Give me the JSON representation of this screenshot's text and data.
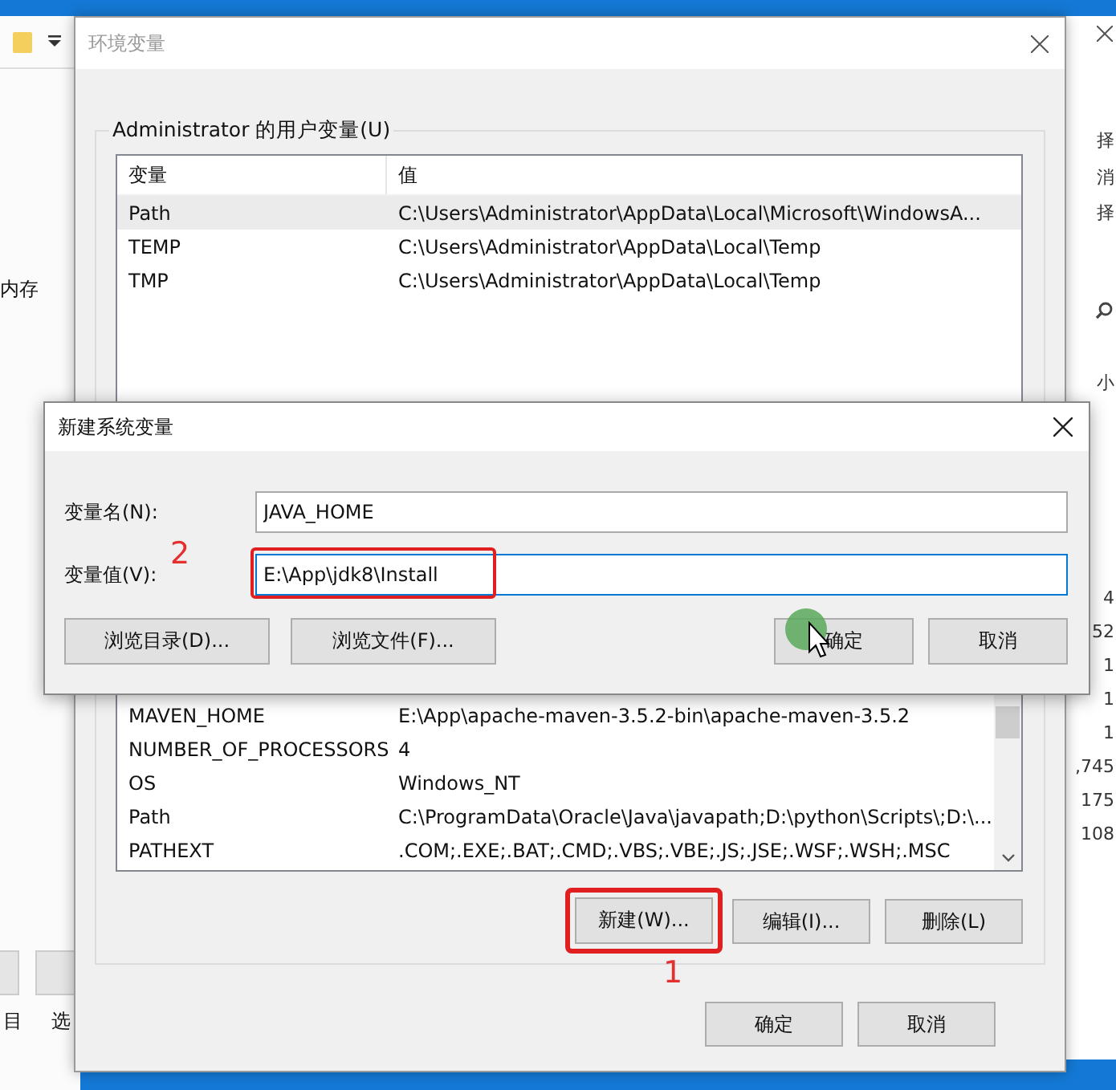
{
  "background_left": {
    "texts": [
      "内存",
      "目",
      "选"
    ]
  },
  "background_right": {
    "texts": [
      "择",
      "消",
      "择",
      "小",
      "4",
      "52",
      "1",
      "1",
      "1",
      ",745",
      "175",
      "108"
    ]
  },
  "env_window": {
    "title": "环境变量",
    "user_vars": {
      "label": "Administrator 的用户变量(U)",
      "columns": [
        "变量",
        "值"
      ],
      "rows": [
        {
          "name": "Path",
          "value": "C:\\Users\\Administrator\\AppData\\Local\\Microsoft\\WindowsA...",
          "selected": true
        },
        {
          "name": "TEMP",
          "value": "C:\\Users\\Administrator\\AppData\\Local\\Temp",
          "selected": false
        },
        {
          "name": "TMP",
          "value": "C:\\Users\\Administrator\\AppData\\Local\\Temp",
          "selected": false
        }
      ]
    },
    "system_vars": {
      "rows": [
        {
          "name": "MAVEN_HOME",
          "value": "E:\\App\\apache-maven-3.5.2-bin\\apache-maven-3.5.2",
          "selected": false
        },
        {
          "name": "NUMBER_OF_PROCESSORS",
          "value": "4",
          "selected": false
        },
        {
          "name": "OS",
          "value": "Windows_NT",
          "selected": false
        },
        {
          "name": "Path",
          "value": "C:\\ProgramData\\Oracle\\Java\\javapath;D:\\python\\Scripts\\;D:\\...",
          "selected": false
        },
        {
          "name": "PATHEXT",
          "value": ".COM;.EXE;.BAT;.CMD;.VBS;.VBE;.JS;.JSE;.WSF;.WSH;.MSC",
          "selected": false
        }
      ]
    },
    "buttons": [
      {
        "label": "新建(W)...",
        "highlighted": true
      },
      {
        "label": "编辑(I)...",
        "highlighted": false
      },
      {
        "label": "删除(L)",
        "highlighted": false
      }
    ],
    "step_mark": "1",
    "footer_buttons": [
      "确定",
      "取消"
    ]
  },
  "new_var_dialog": {
    "title": "新建系统变量",
    "step_mark": "2",
    "fields": [
      {
        "label": "变量名(N):",
        "value": "JAVA_HOME",
        "focused": false,
        "highlighted": false
      },
      {
        "label": "变量值(V):",
        "value": "E:\\App\\jdk8\\Install",
        "focused": true,
        "highlighted": true
      }
    ],
    "buttons": [
      "浏览目录(D)...",
      "浏览文件(F)...",
      "确定",
      "取消"
    ]
  }
}
